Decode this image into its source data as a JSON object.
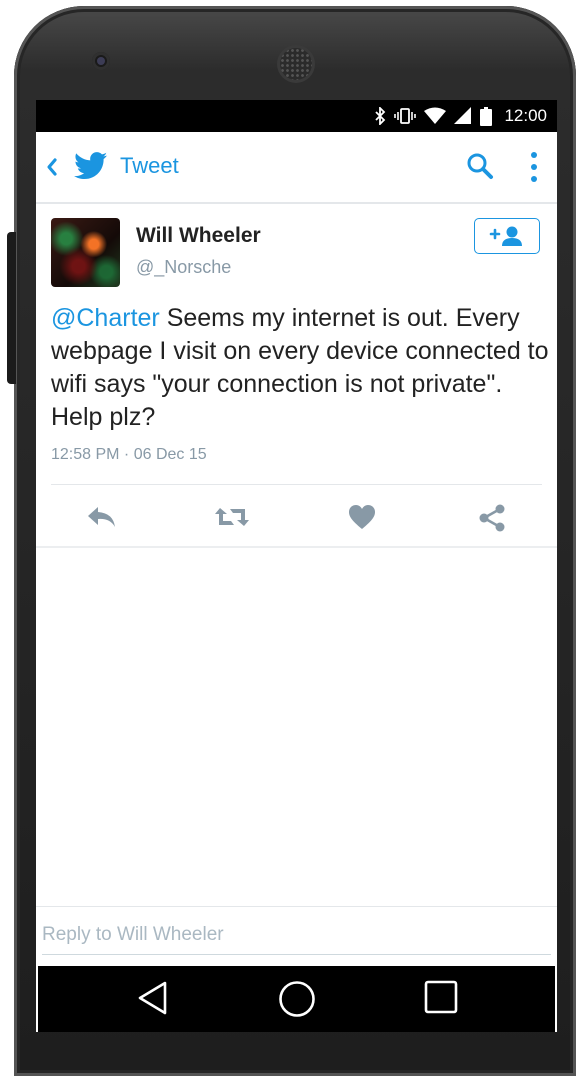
{
  "status_bar": {
    "time": "12:00",
    "icons": [
      "bluetooth-icon",
      "vibrate-icon",
      "wifi-icon",
      "signal-icon",
      "battery-icon"
    ]
  },
  "app_bar": {
    "title": "Tweet",
    "icons": [
      "back-icon",
      "twitter-bird-icon",
      "search-icon",
      "overflow-menu-icon"
    ]
  },
  "tweet": {
    "user_name": "Will Wheeler",
    "handle": "@_Norsche",
    "mention": "@Charter",
    "body": " Seems my internet is out. Every webpage I visit on every device connected to wifi says \"your connection is not private\". Help plz?",
    "timestamp": "12:58 PM · 06 Dec 15",
    "follow_button_icon": "add-user-icon"
  },
  "actions": [
    "reply-icon",
    "retweet-icon",
    "like-icon",
    "share-icon"
  ],
  "reply": {
    "placeholder": "Reply to Will Wheeler",
    "value": ""
  },
  "nav_bar": [
    "nav-back-icon",
    "nav-home-icon",
    "nav-recents-icon"
  ],
  "colors": {
    "accent": "#1b95e0",
    "action_gray": "#8899a6",
    "text": "#222222",
    "secondary_text": "#8899a6"
  }
}
